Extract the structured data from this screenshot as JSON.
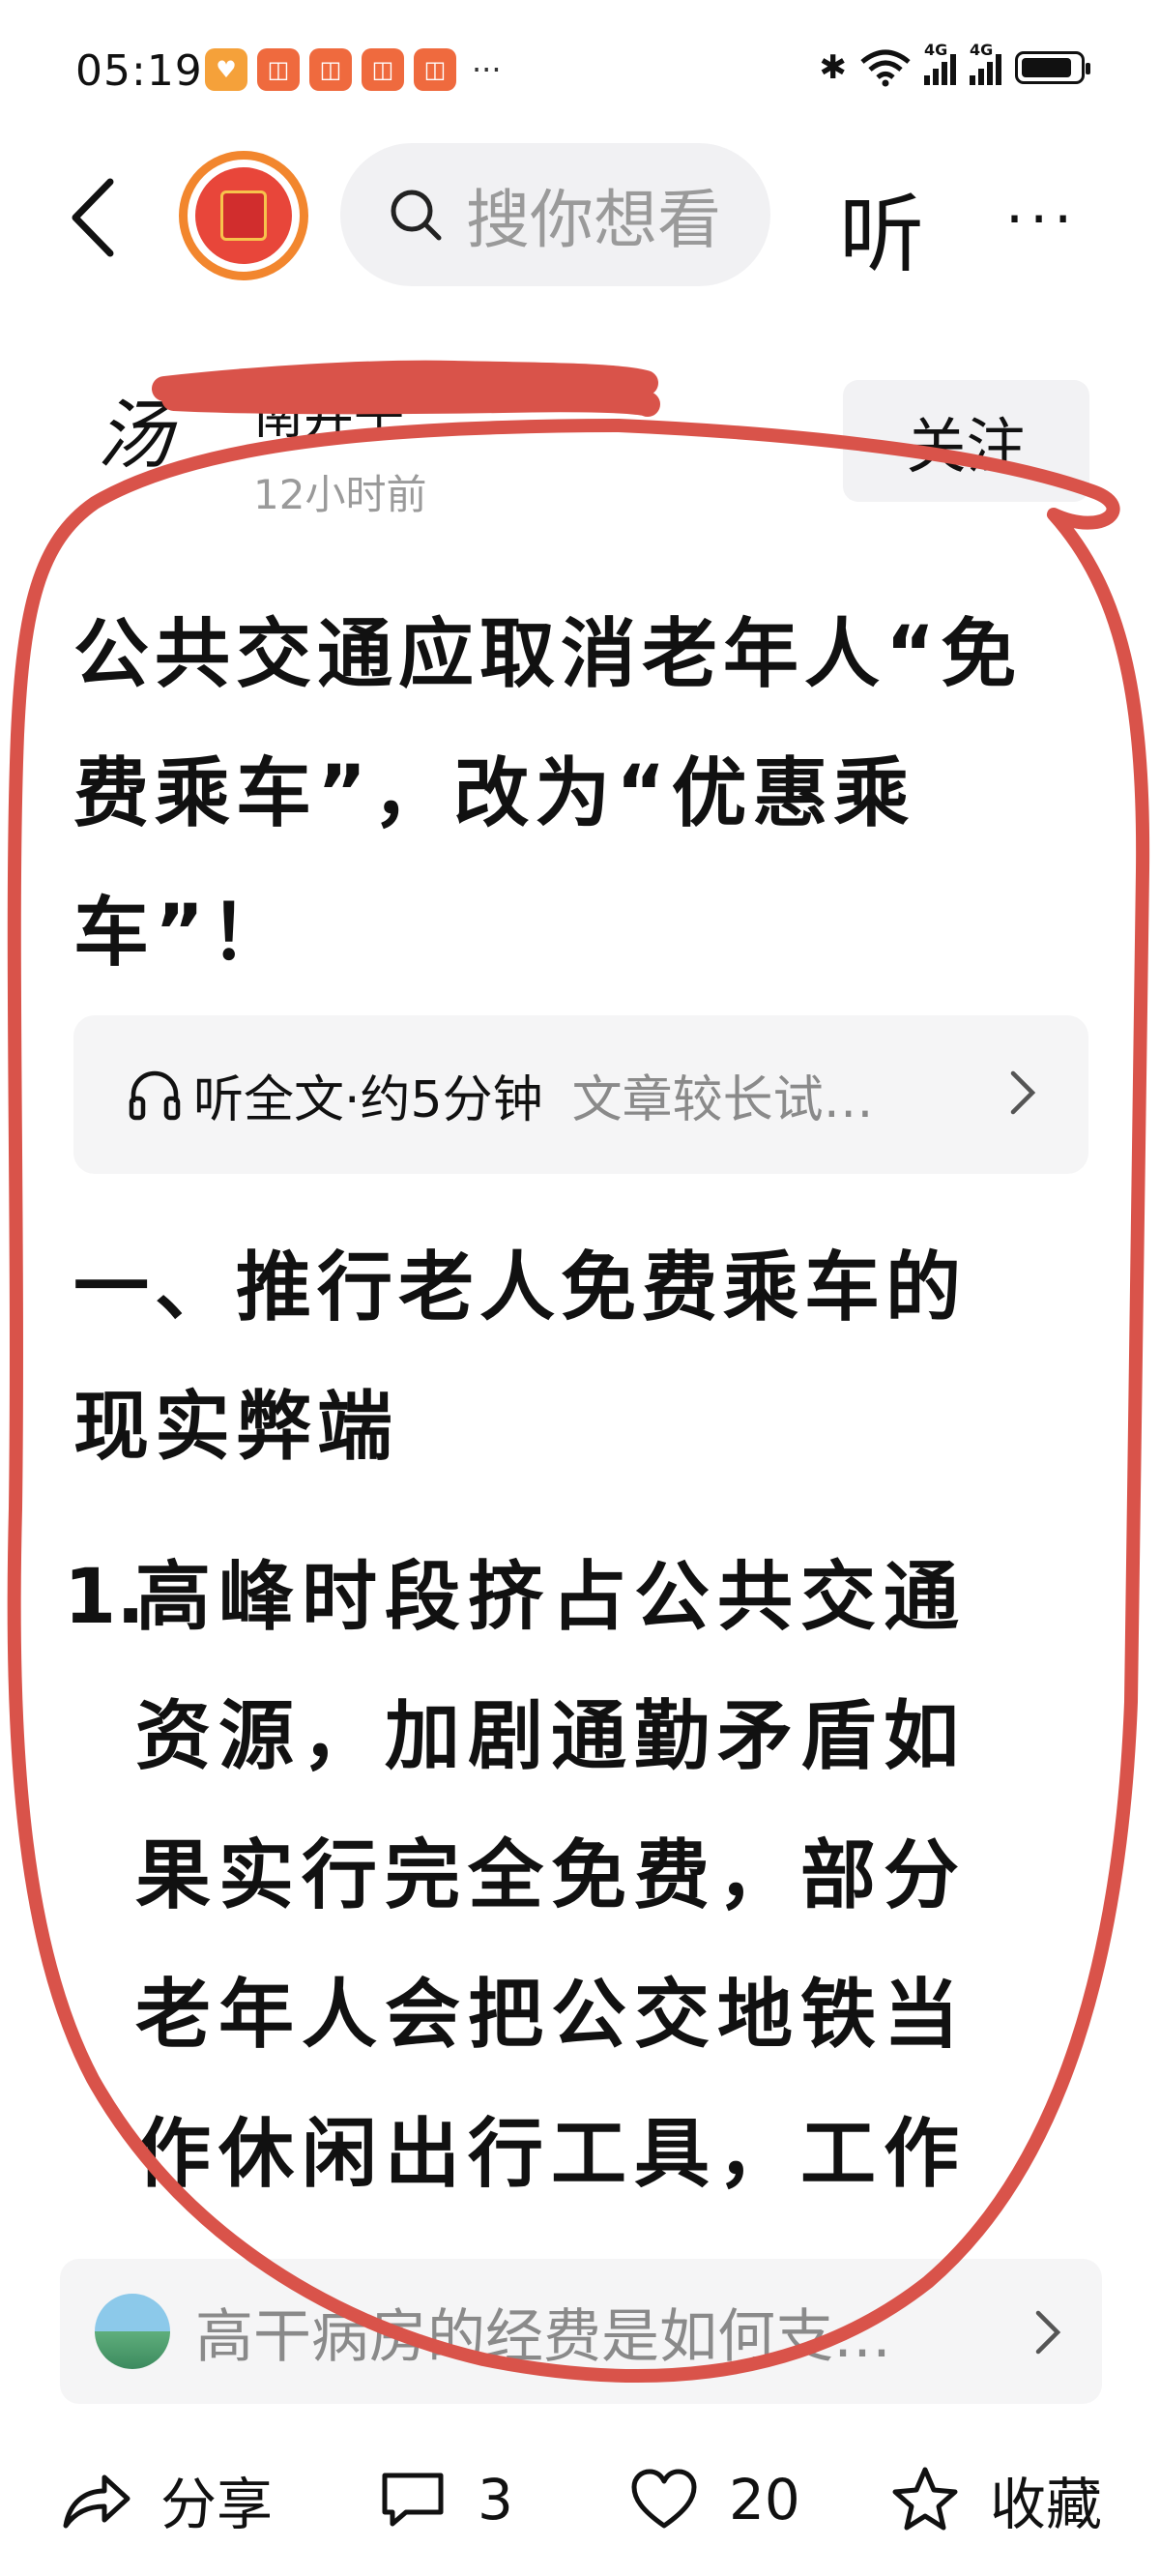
{
  "status_bar": {
    "time": "05:19",
    "notif_more": "···",
    "network_1": "4G",
    "network_2": "4G",
    "icons": [
      "heart-app-icon",
      "app-icon",
      "app-icon",
      "app-icon",
      "app-icon",
      "bluetooth-icon",
      "wifi-icon",
      "signal-icon",
      "signal-icon",
      "battery-icon"
    ]
  },
  "top_nav": {
    "search_placeholder": "搜你想看",
    "listen_label": "听",
    "more_label": "···"
  },
  "author": {
    "name": "南井子",
    "time": "12小时前",
    "follow_label": "关注"
  },
  "article": {
    "title": "公共交通应取消老年人“免费乘车”，改为“优惠乘车”！",
    "listen_label": "听全文·约5分钟",
    "listen_hint": "文章较长试…",
    "section_heading": "一、推行老人免费乘车的现实弊端",
    "para_number": "1.",
    "para_body": "高峰时段挤占公共交通资源，加剧通勤矛盾如果实行完全免费，部分老年人会把公交地铁当作休闲出行工具，工作"
  },
  "related": {
    "text": "高干病房的经费是如何支…"
  },
  "bottom_bar": {
    "share_label": "分享",
    "comment_count": "3",
    "like_count": "20",
    "favorite_label": "收藏"
  },
  "colors": {
    "annotation_red": "#d9534a",
    "logo_orange": "#f2862e",
    "muted_text": "#9a9a9a"
  }
}
